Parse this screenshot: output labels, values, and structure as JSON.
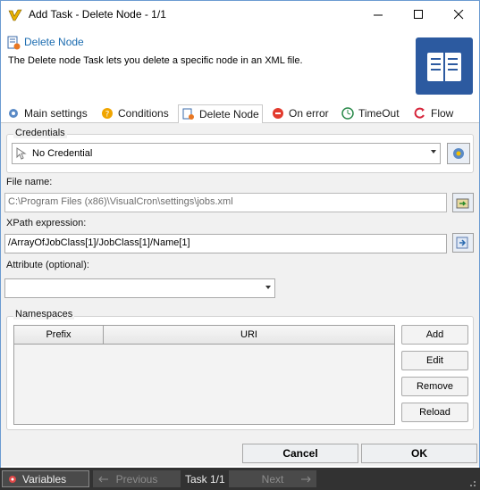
{
  "window": {
    "title": "Add Task - Delete Node - 1/1",
    "minimize_icon": "minimize-icon",
    "maximize_icon": "maximize-icon",
    "close_icon": "close-icon"
  },
  "header": {
    "title": "Delete Node",
    "description": "The Delete node Task lets you delete a specific node in an XML file.",
    "big_icon": "book-icon"
  },
  "tabs": [
    {
      "label": "Main settings",
      "icon": "gear-icon"
    },
    {
      "label": "Conditions",
      "icon": "help-icon"
    },
    {
      "label": "Delete Node",
      "icon": "node-icon",
      "active": true
    },
    {
      "label": "On error",
      "icon": "stop-icon"
    },
    {
      "label": "TimeOut",
      "icon": "clock-icon"
    },
    {
      "label": "Flow",
      "icon": "flow-icon"
    }
  ],
  "credentials": {
    "group_label": "Credentials",
    "selected": "No Credential"
  },
  "file": {
    "label": "File name:",
    "value": "C:\\Program Files (x86)\\VisualCron\\settings\\jobs.xml"
  },
  "xpath": {
    "label": "XPath expression:",
    "value": "/ArrayOfJobClass[1]/JobClass[1]/Name[1]"
  },
  "attribute": {
    "label": "Attribute (optional):",
    "value": ""
  },
  "namespaces": {
    "group_label": "Namespaces",
    "columns": [
      "Prefix",
      "URI"
    ],
    "buttons": {
      "add": "Add",
      "edit": "Edit",
      "remove": "Remove",
      "reload": "Reload"
    }
  },
  "footer": {
    "cancel": "Cancel",
    "ok": "OK"
  },
  "statusbar": {
    "variables": "Variables",
    "previous": "Previous",
    "task": "Task 1/1",
    "next": "Next"
  },
  "colors": {
    "accent": "#1c6cb0",
    "header_icon_bg": "#2c5aa0",
    "statusbar_bg": "#323232"
  }
}
